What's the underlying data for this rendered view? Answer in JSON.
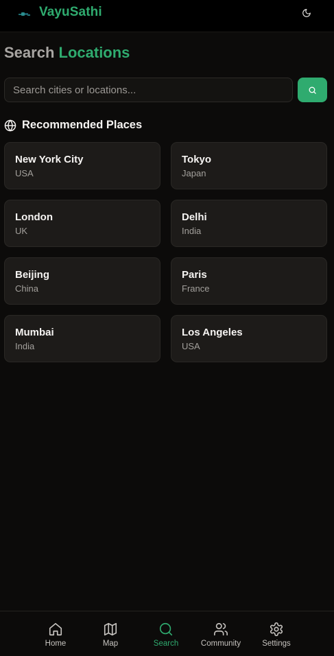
{
  "app": {
    "brand": "VayuSathi"
  },
  "page": {
    "title_part1": "Search",
    "title_part2": "Locations"
  },
  "search": {
    "placeholder": "Search cities or locations...",
    "value": ""
  },
  "recommended": {
    "heading": "Recommended Places",
    "places": [
      {
        "city": "New York City",
        "country": "USA"
      },
      {
        "city": "Tokyo",
        "country": "Japan"
      },
      {
        "city": "London",
        "country": "UK"
      },
      {
        "city": "Delhi",
        "country": "India"
      },
      {
        "city": "Beijing",
        "country": "China"
      },
      {
        "city": "Paris",
        "country": "France"
      },
      {
        "city": "Mumbai",
        "country": "India"
      },
      {
        "city": "Los Angeles",
        "country": "USA"
      }
    ]
  },
  "nav": {
    "items": [
      {
        "label": "Home",
        "icon": "home-icon",
        "active": false
      },
      {
        "label": "Map",
        "icon": "map-icon",
        "active": false
      },
      {
        "label": "Search",
        "icon": "search-icon",
        "active": true
      },
      {
        "label": "Community",
        "icon": "users-icon",
        "active": false
      },
      {
        "label": "Settings",
        "icon": "gear-icon",
        "active": false
      }
    ]
  },
  "colors": {
    "accent": "#2fab6f",
    "background": "#0c0b0a",
    "card": "#1d1b19",
    "topbar": "#000000"
  }
}
